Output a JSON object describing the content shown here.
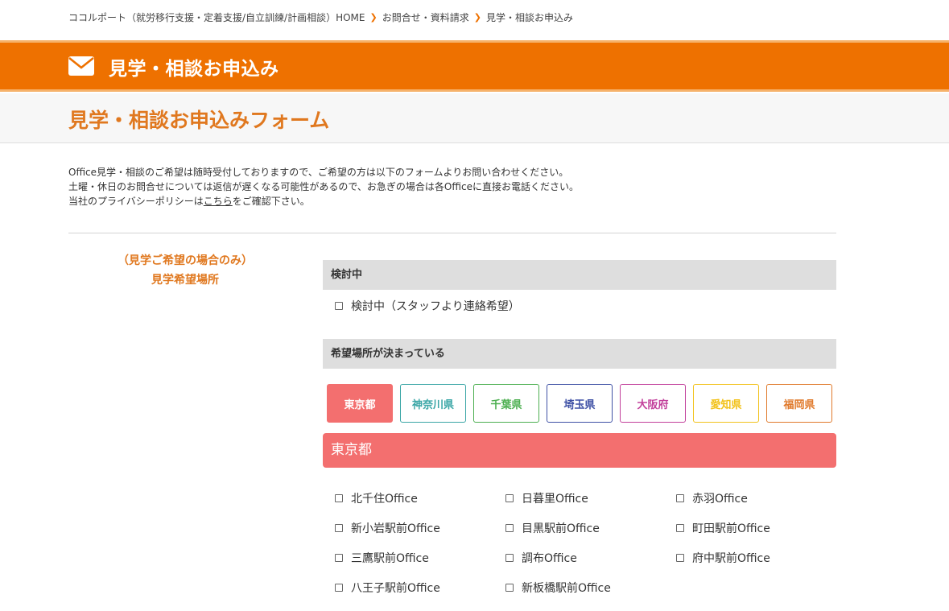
{
  "breadcrumb": {
    "home": "ココルポート（就労移行支援・定着支援/自立訓練/計画相談）HOME",
    "level2": "お問合せ・資料請求",
    "current": "見学・相談お申込み"
  },
  "hero": {
    "title": "見学・相談お申込み",
    "icon": "mail-icon"
  },
  "form": {
    "heading": "見学・相談お申込みフォーム",
    "intro_line1": "Office見学・相談のご希望は随時受付しておりますので、ご希望の方は以下のフォームよりお問い合わせください。",
    "intro_line2": "土曜・休日のお問合せについては返信が遅くなる可能性があるので、お急ぎの場合は各Officeに直接お電話ください。",
    "intro_line3_prefix": "当社のプライバシーポリシーは",
    "intro_line3_link": "こちら",
    "intro_line3_suffix": "をご確認下さい。"
  },
  "field": {
    "label_line1": "（見学ご希望の場合のみ）",
    "label_line2": "見学希望場所"
  },
  "section_considering": {
    "title": "検討中",
    "option": "検討中（スタッフより連絡希望）"
  },
  "section_decided": {
    "title": "希望場所が決まっている"
  },
  "prefectures": [
    {
      "label": "東京都",
      "color": "#f36f6f",
      "active": true
    },
    {
      "label": "神奈川県",
      "color": "#3aa6a6",
      "active": false
    },
    {
      "label": "千葉県",
      "color": "#4caf50",
      "active": false
    },
    {
      "label": "埼玉県",
      "color": "#3f51a5",
      "active": false
    },
    {
      "label": "大阪府",
      "color": "#c2409b",
      "active": false
    },
    {
      "label": "愛知県",
      "color": "#f2c21b",
      "active": false
    },
    {
      "label": "福岡県",
      "color": "#e07a2c",
      "active": false
    }
  ],
  "region": {
    "title": "東京都",
    "offices": [
      "北千住Office",
      "日暮里Office",
      "赤羽Office",
      "新小岩駅前Office",
      "目黒駅前Office",
      "町田駅前Office",
      "三鷹駅前Office",
      "調布Office",
      "府中駅前Office",
      "八王子駅前Office",
      "新板橋駅前Office"
    ]
  },
  "colors": {
    "accent": "#ee7100",
    "heading": "#e0781f",
    "tokyo": "#f36f6f"
  }
}
